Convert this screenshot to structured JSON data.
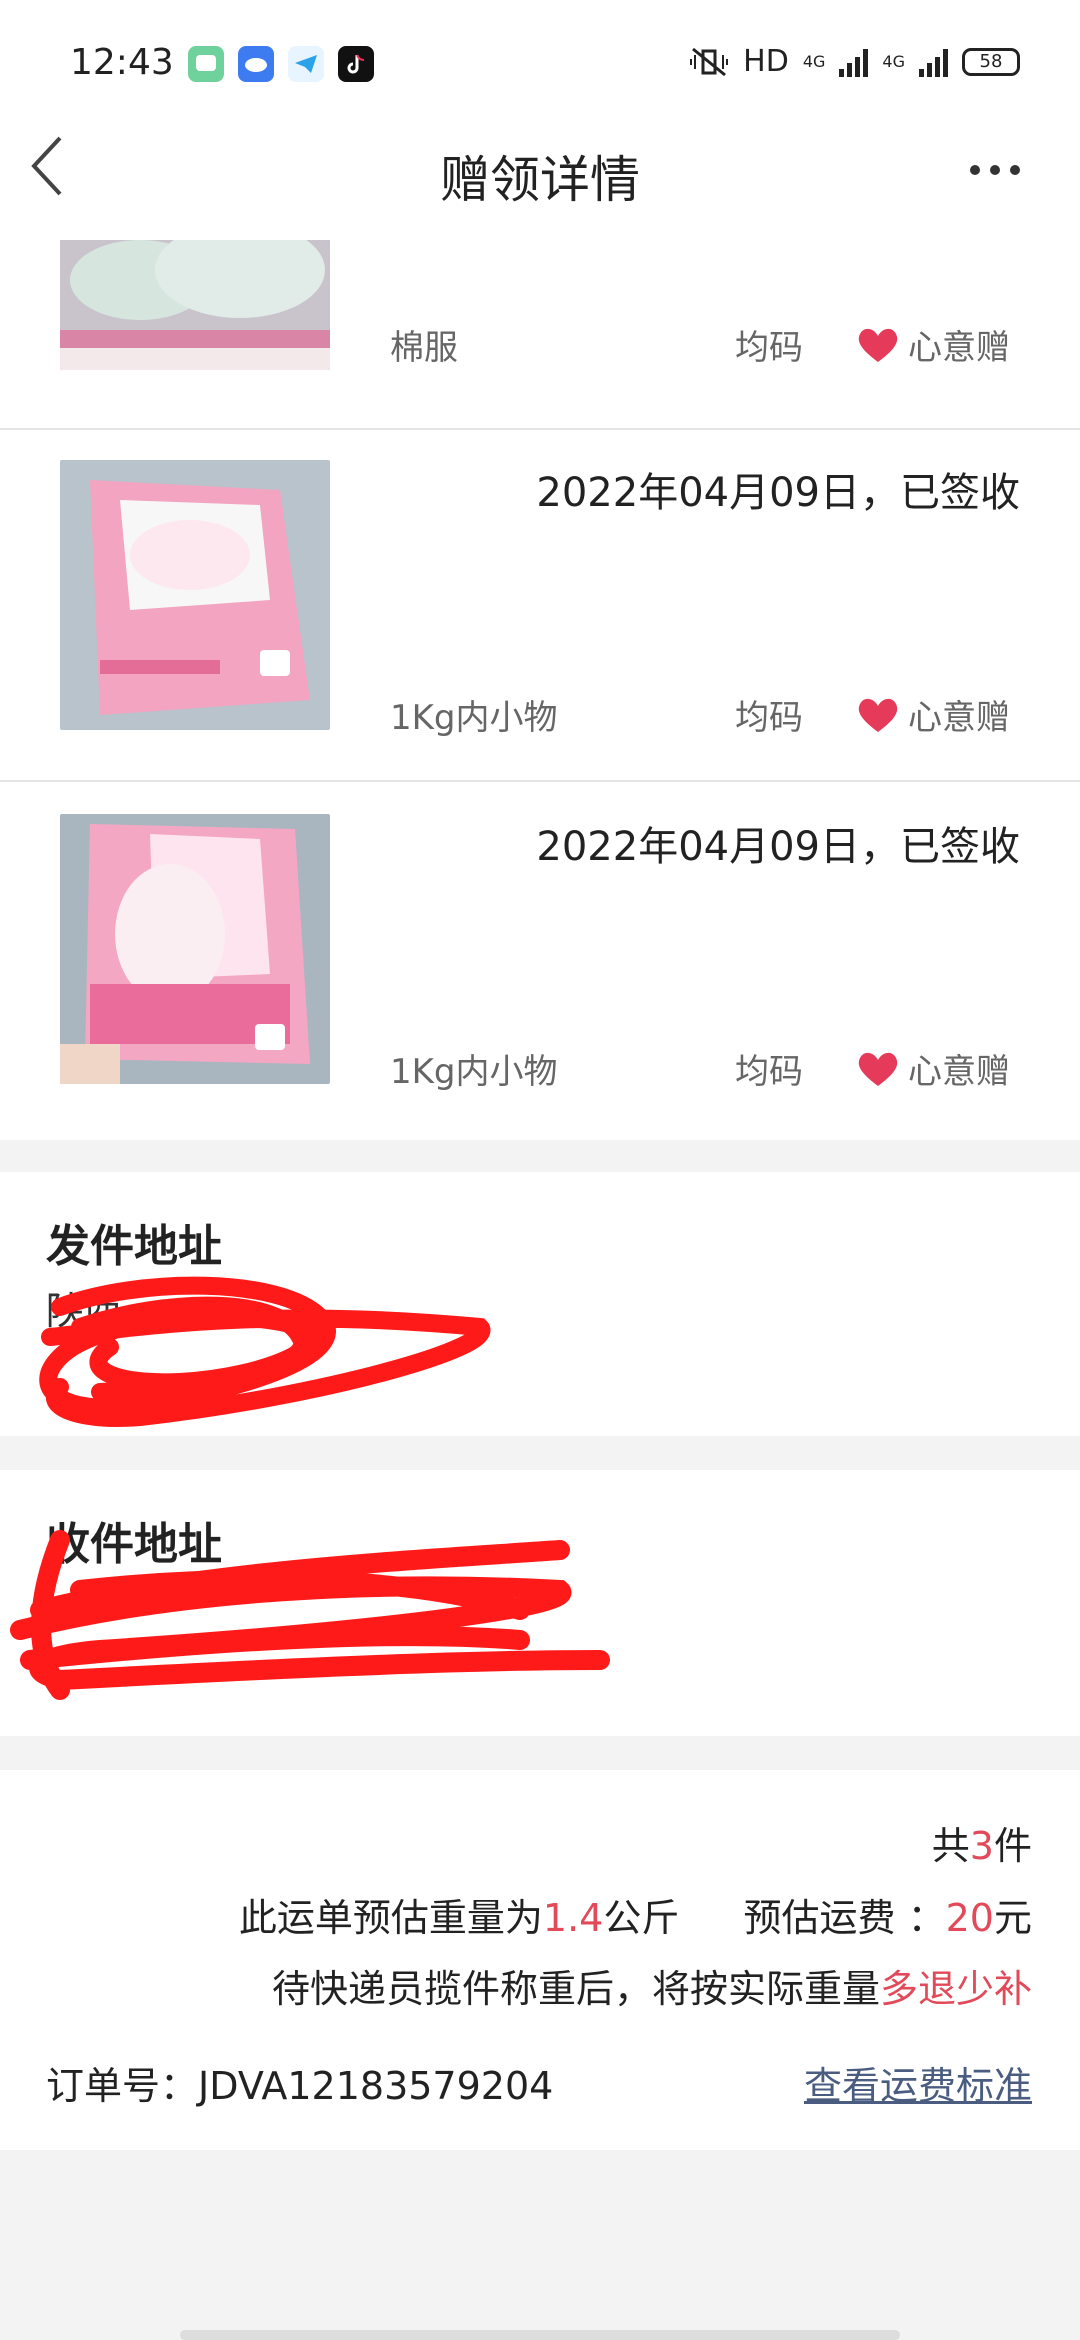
{
  "status_bar": {
    "time": "12:43",
    "network": "HD",
    "signal_1": "4G",
    "signal_2": "4G",
    "battery": "58"
  },
  "header": {
    "title": "赠领详情"
  },
  "items": [
    {
      "date": "",
      "name": "棉服",
      "size": "均码",
      "type": "心意赠"
    },
    {
      "date": "2022年04月09日，已签收",
      "name": "1Kg内小物",
      "size": "均码",
      "type": "心意赠"
    },
    {
      "date": "2022年04月09日，已签收",
      "name": "1Kg内小物",
      "size": "均码",
      "type": "心意赠"
    }
  ],
  "sender": {
    "title": "发件地址",
    "line1": "陕西",
    "line2": ""
  },
  "receiver": {
    "title": "收件地址",
    "line1": "",
    "line2": ""
  },
  "summary": {
    "count_prefix": "共",
    "count": "3",
    "count_suffix": "件",
    "weight_prefix": "此运单预估重量为",
    "weight": "1.4",
    "weight_unit": "公斤",
    "fee_label": "预估运费 ：",
    "fee": "20",
    "fee_unit": "元",
    "notice_prefix": "待快递员揽件称重后，将按实际重量",
    "notice_highlight": "多退少补",
    "order_label": "订单号：",
    "order_no": "JDVA12183579204",
    "fee_link": "查看运费标准"
  },
  "colors": {
    "accent": "#e24a5a",
    "link": "#4a5d80",
    "scribble": "#ff0000"
  }
}
